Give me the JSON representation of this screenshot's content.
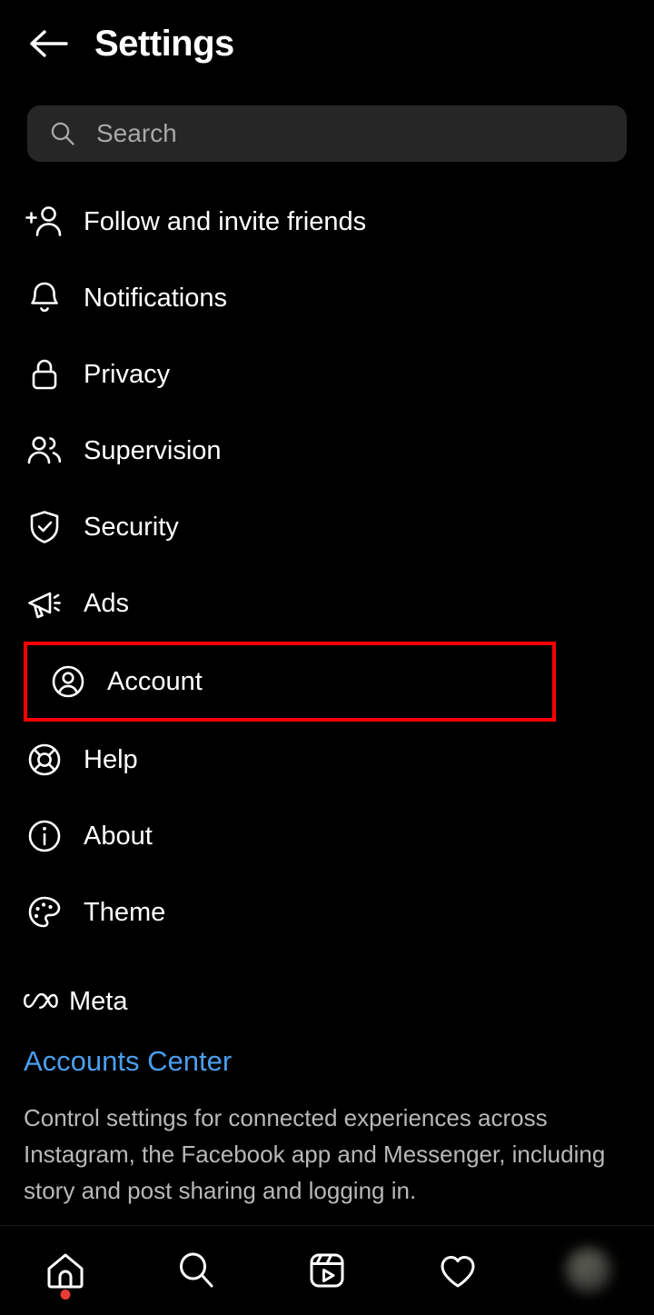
{
  "header": {
    "back_icon": "back-arrow-icon",
    "title": "Settings"
  },
  "search": {
    "icon": "search-icon",
    "placeholder": "Search",
    "value": ""
  },
  "menu": {
    "items": [
      {
        "label": "Follow and invite friends",
        "icon": "person-add-icon",
        "highlighted": false
      },
      {
        "label": "Notifications",
        "icon": "bell-icon",
        "highlighted": false
      },
      {
        "label": "Privacy",
        "icon": "lock-icon",
        "highlighted": false
      },
      {
        "label": "Supervision",
        "icon": "people-icon",
        "highlighted": false
      },
      {
        "label": "Security",
        "icon": "shield-check-icon",
        "highlighted": false
      },
      {
        "label": "Ads",
        "icon": "megaphone-icon",
        "highlighted": false
      },
      {
        "label": "Account",
        "icon": "account-circle-icon",
        "highlighted": true
      },
      {
        "label": "Help",
        "icon": "life-ring-icon",
        "highlighted": false
      },
      {
        "label": "About",
        "icon": "info-circle-icon",
        "highlighted": false
      },
      {
        "label": "Theme",
        "icon": "palette-icon",
        "highlighted": false
      }
    ]
  },
  "meta_section": {
    "logo_icon": "meta-infinity-logo",
    "brand_name": "Meta",
    "link_label": "Accounts Center",
    "description": "Control settings for connected experiences across Instagram, the Facebook app and Messenger, including story and post sharing and logging in."
  },
  "bottom_nav": {
    "items": [
      {
        "name": "home",
        "icon": "home-icon",
        "badge": true
      },
      {
        "name": "search",
        "icon": "search-icon",
        "badge": false
      },
      {
        "name": "reels",
        "icon": "reels-icon",
        "badge": false
      },
      {
        "name": "activity",
        "icon": "heart-icon",
        "badge": false
      },
      {
        "name": "profile",
        "icon": "avatar-icon",
        "badge": false
      }
    ]
  },
  "colors": {
    "background": "#000000",
    "text_primary": "#ffffff",
    "text_secondary": "#b8b8b8",
    "search_field": "#262626",
    "link_blue": "#4a9eed",
    "highlight_red": "#ff0000",
    "badge_red": "#e83b36"
  }
}
